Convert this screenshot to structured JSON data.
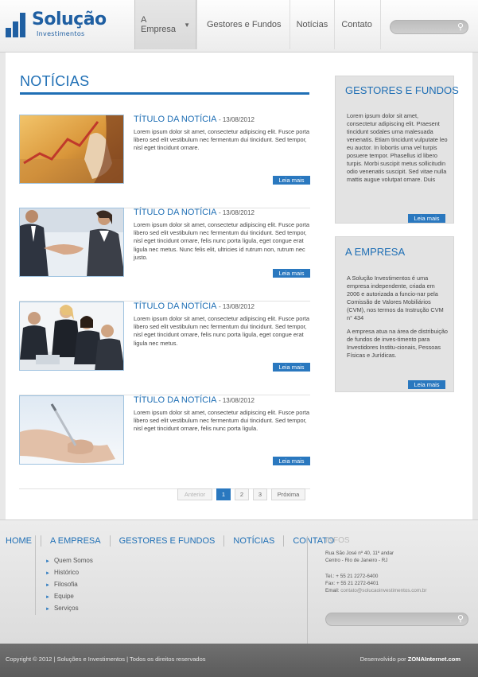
{
  "header": {
    "logo_title": "Solução",
    "logo_subtitle": "Investimentos",
    "nav": [
      {
        "label": "A Empresa"
      },
      {
        "label": "Gestores e Fundos"
      },
      {
        "label": "Notícias"
      },
      {
        "label": "Contato"
      }
    ],
    "search_placeholder": ""
  },
  "main": {
    "title": "NOTÍCIAS",
    "news": [
      {
        "title": "TÍTULO DA NOTÍCIA",
        "date": "13/08/2012",
        "text": "Lorem ipsum dolor sit amet, consectetur adipiscing elit. Fusce porta libero sed elit vestibulum nec fermentum dui tincidunt. Sed tempor, nisl eget tincidunt ornare.",
        "more": "Leia mais",
        "image": "business-chart-hand-photo"
      },
      {
        "title": "TÍTULO DA NOTÍCIA",
        "date": "13/08/2012",
        "text": "Lorem ipsum dolor sit amet, consectetur adipiscing elit. Fusce porta libero sed elit vestibulum nec fermentum dui tincidunt. Sed tempor, nisl eget tincidunt ornare, felis nunc porta ligula, eget congue erat ligula nec metus. Nunc felis elit, ultricies id rutrum non, rutrum nec justo.",
        "more": "Leia mais",
        "image": "handshake-photo"
      },
      {
        "title": "TÍTULO DA NOTÍCIA",
        "date": "13/08/2012",
        "text": "Lorem ipsum dolor sit amet, consectetur adipiscing elit. Fusce porta libero sed elit vestibulum nec fermentum dui tincidunt. Sed tempor, nisl eget tincidunt ornare, felis nunc porta ligula, eget congue erat ligula nec metus.",
        "more": "Leia mais",
        "image": "business-meeting-photo"
      },
      {
        "title": "TÍTULO DA NOTÍCIA",
        "date": "13/08/2012",
        "text": "Lorem ipsum dolor sit amet, consectetur adipiscing elit. Fusce porta libero sed elit vestibulum nec fermentum dui tincidunt. Sed tempor, nisl eget tincidunt ornare, felis nunc porta ligula.",
        "more": "Leia mais",
        "image": "signing-document-photo"
      }
    ],
    "pager": {
      "prev": "Anterior",
      "pages": [
        "1",
        "2",
        "3"
      ],
      "current": "1",
      "next": "Próxima"
    }
  },
  "sidebar": {
    "funds": {
      "title": "GESTORES E FUNDOS",
      "text": "Lorem ipsum dolor sit amet, consectetur adipiscing elit. Praesent tincidunt sodales urna malesuada venenatis. Etiam tincidunt vulputate leo eu auctor. In lobortis urna vel turpis posuere tempor. Phasellus id libero turpis. Morbi suscipit metus sollicitudin odio venenatis suscipit. Sed vitae nulla mattis augue volutpat ornare. Duis",
      "more": "Leia mais"
    },
    "company": {
      "title": "A EMPRESA",
      "text1": "A Solução Investimentos é uma empresa independente, criada em 2006 e autorizada a funcio-nar pela Comissão de Valores Mobiliários (CVM), nos termos da Instrução CVM n° 434",
      "text2": "A empresa atua na área de distribuição de fundos de inves-timento para Investidores Institu-cionais, Pessoas Físicas e Jurídicas.",
      "more": "Leia mais"
    }
  },
  "footer": {
    "nav": [
      "HOME",
      "A EMPRESA",
      "GESTORES E FUNDOS",
      "NOTÍCIAS",
      "CONTATO"
    ],
    "sub": [
      "Quem Somos",
      "Histórico",
      "Filosofia",
      "Equipe",
      "Serviços"
    ],
    "info": {
      "title": "INFOS",
      "address1": "Rua São José nº 40, 11º andar",
      "address2": "Centro - Rio de Janeiro - RJ",
      "tel": "Tel.: + 55  21  2272-6400",
      "fax": "Fax: + 55  21  2272-6401",
      "email_label": "Email: ",
      "email": "contato@solucaoinvestimentos.com.br"
    },
    "copyright": "Copyright © 2012 | Soluções e Investimentos |  Todos os direitos reservados",
    "dev_label": "Desenvolvido por ",
    "dev_name": "ZONAInternet.com"
  },
  "colors": {
    "accent": "#1f6fb5",
    "button": "#2a78bf"
  }
}
